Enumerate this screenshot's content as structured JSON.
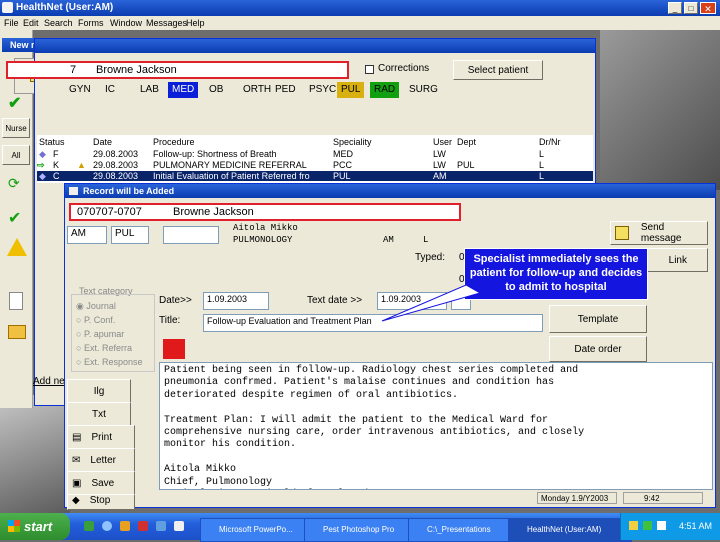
{
  "app": {
    "title": "HealthNet (User:AM)",
    "menu": [
      "File",
      "Edit",
      "Search",
      "Forms",
      "Window",
      "Messages",
      "Help"
    ]
  },
  "sidebar": {
    "new_message_title": "New mes...",
    "buttons": [
      "Nurse",
      "All"
    ]
  },
  "patient_window": {
    "patient_id": "7",
    "patient_name": "Browne Jackson",
    "corrections_label": "Corrections",
    "select_patient": "Select patient",
    "tabs": [
      "GYN",
      "IC",
      "LAB",
      "MED",
      "OB",
      "ORTH",
      "PED",
      "PSYC",
      "PUL",
      "RAD",
      "SURG"
    ],
    "columns": [
      "Status",
      "Date",
      "Procedure",
      "Speciality",
      "User",
      "Dept",
      "Dr/Nr"
    ],
    "rows": [
      {
        "status": "F",
        "date": "29.08.2003",
        "procedure": "Follow-up: Shortness of Breath",
        "speciality": "MED",
        "user": "LW",
        "dept": "",
        "drnr": "L"
      },
      {
        "status": "K",
        "date": "29.08.2003",
        "procedure": "PULMONARY MEDICINE REFERRAL",
        "speciality": "PCC",
        "user": "LW",
        "dept": "PUL",
        "drnr": "L"
      },
      {
        "status": "C",
        "date": "29.08.2003",
        "procedure": "Initial Evaluation of Patient Referred fro",
        "speciality": "PUL",
        "user": "AM",
        "dept": "",
        "drnr": "L"
      }
    ],
    "add_new": "Add ne"
  },
  "record_window": {
    "title": "Record will be Added",
    "patient_id": "070707-0707",
    "patient_name": "Browne Jackson",
    "user": "AM",
    "dept": "PUL",
    "doctor_name": "Aitola Mikko",
    "doctor_specialty": "PULMONOLOGY",
    "doctor_user": "AM",
    "doctor_flag": "L",
    "typed_label": "Typed:",
    "typed_value": "0",
    "send_message": "Send message",
    "link": "Link",
    "text_category_label": "Text category",
    "categories": [
      "Journal",
      "P. Conf.",
      "P. apumar",
      "Ext. Referra",
      "Ext. Response"
    ],
    "date_label": "Date>>",
    "date_value": "1.09.2003",
    "text_date_label": "Text date >>",
    "text_date_value": "1.09.2003",
    "title_label": "Title:",
    "title_value": "Follow-up Evaluation and Treatment Plan",
    "template": "Template",
    "date_order": "Date order",
    "left_buttons": [
      "Ilg",
      "Txt",
      "Print",
      "Letter",
      "Save",
      "Stop"
    ],
    "body_text": "Patient being seen in follow-up. Radiology chest series completed and\npneumonia confrmed. Patient's malaise continues and condition has\ndeteriorated despite regimen of oral antibiotics.\n\nTreatment Plan: I will admit the patient to the Medical Ward for\ncomprehensive nursing care, order intravenous antibiotics, and closely\nmonitor his condition.\n\nAitola Mikko\nChief, Pulmonology\nCapital City Hospital/Pulmonology/amo",
    "status_date": "Monday 1.9/Y2003",
    "status_time": "9:42"
  },
  "callout": {
    "text": "Specialist immediately sees the patient for follow-up and decides to admit to hospital"
  },
  "taskbar": {
    "start": "start",
    "tasks": [
      "Microsoft PowerPo...",
      "Pest Photoshop Pro",
      "C:\\_Presentations",
      "HealthNet (User:AM)"
    ],
    "clock": "4:51 AM"
  },
  "colors": {
    "tab_med": "#0b1fd8",
    "tab_pul": "#d8b010",
    "tab_rad": "#10a010",
    "highlight_border": "#e0202a",
    "callout": "#1515e0",
    "taskbar": "#245edb"
  }
}
